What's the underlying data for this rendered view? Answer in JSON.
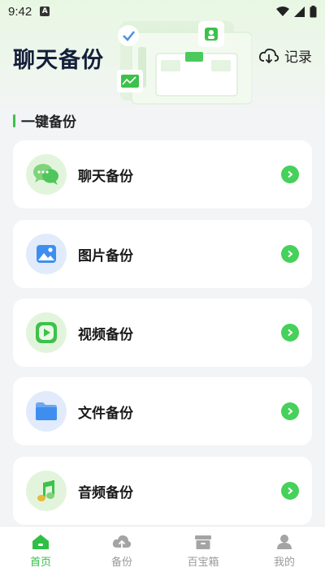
{
  "status_bar": {
    "time": "9:42",
    "notification": "A"
  },
  "header": {
    "title": "聊天备份",
    "record_label": "记录"
  },
  "section": {
    "title": "一键备份"
  },
  "cards": [
    {
      "label": "聊天备份",
      "icon": "chat-bubble-icon"
    },
    {
      "label": "图片备份",
      "icon": "image-icon"
    },
    {
      "label": "视频备份",
      "icon": "video-play-icon"
    },
    {
      "label": "文件备份",
      "icon": "folder-icon"
    },
    {
      "label": "音频备份",
      "icon": "music-note-icon"
    }
  ],
  "nav": [
    {
      "label": "首页",
      "icon": "home-icon",
      "active": true
    },
    {
      "label": "备份",
      "icon": "cloud-upload-icon",
      "active": false
    },
    {
      "label": "百宝箱",
      "icon": "box-icon",
      "active": false
    },
    {
      "label": "我的",
      "icon": "person-icon",
      "active": false
    }
  ],
  "colors": {
    "accent": "#45d15a",
    "active_nav": "#2fbf44",
    "title": "#14203a"
  }
}
